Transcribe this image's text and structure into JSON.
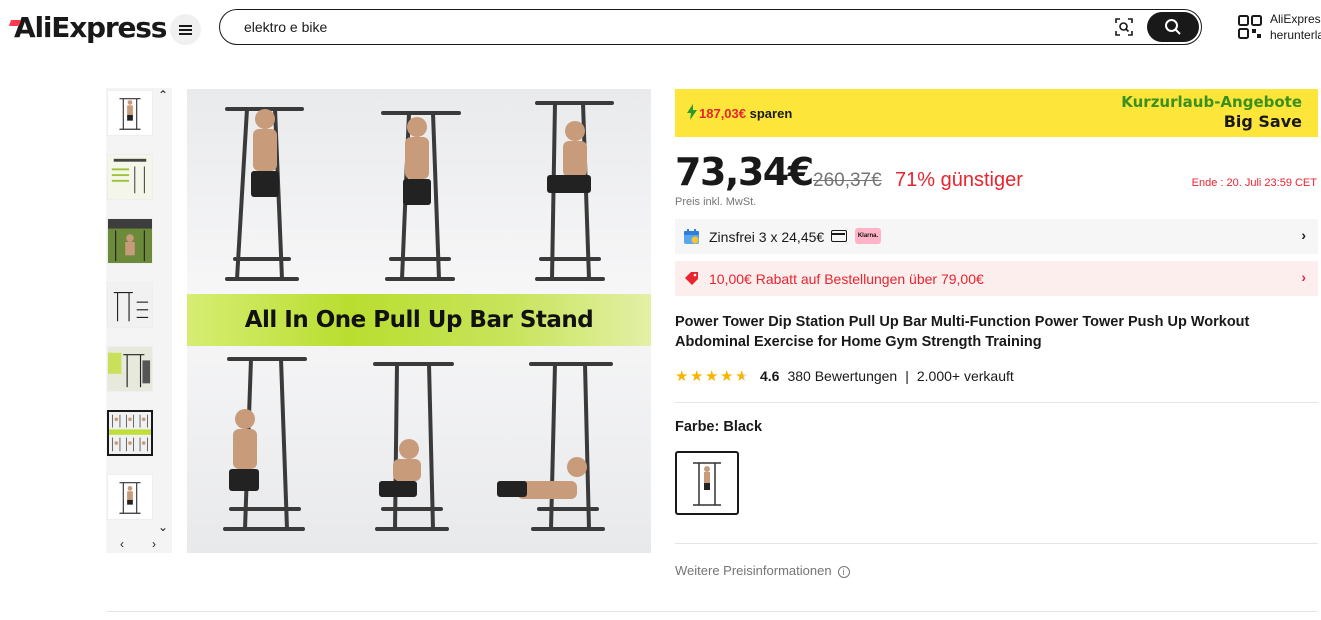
{
  "header": {
    "logo": "AliExpress",
    "search_value": "elektro e bike",
    "app_promo_line1": "AliExpress",
    "app_promo_line2": "herunterladen"
  },
  "promo": {
    "savings_amount": "187,03€",
    "savings_word": "sparen",
    "campaign_title": "Kurzurlaub-Angebote",
    "campaign_subtitle": "Big Save"
  },
  "pricing": {
    "current_price": "73,34€",
    "original_price": "260,37€",
    "discount": "71% günstiger",
    "ends": "Ende : 20. Juli 23:59 CET",
    "tax_note": "Preis inkl. MwSt."
  },
  "installment": {
    "text": "Zinsfrei 3 x 24,45€",
    "provider": "Klarna."
  },
  "coupon": {
    "text": "10,00€ Rabatt auf Bestellungen über 79,00€"
  },
  "product": {
    "title": "Power Tower Dip Station Pull Up Bar Multi-Function Power Tower Push Up Workout Abdominal Exercise for Home Gym Strength Training",
    "rating": "4.6",
    "rating_stars": 4.6,
    "reviews": "380 Bewertungen",
    "sold": "2.000+ verkauft",
    "image_banner_text": "All In One Pull Up Bar Stand",
    "color_label": "Farbe: Black"
  },
  "more_info": "Weitere Preisinformationen",
  "colors": {
    "brand_red": "#fd384f",
    "promo_yellow": "#fde53a",
    "discount_red": "#e8242f",
    "promo_green": "#3b8f1c",
    "star": "#f7b500"
  },
  "icons": [
    "menu-icon",
    "camera-search-icon",
    "search-icon",
    "qr-code-icon",
    "bolt-icon",
    "calendar-icon",
    "card-icon",
    "coupon-tag-icon",
    "chevron-right-icon",
    "info-icon",
    "chevron-up-icon",
    "chevron-down-icon",
    "chevron-left-icon",
    "star-icon"
  ]
}
